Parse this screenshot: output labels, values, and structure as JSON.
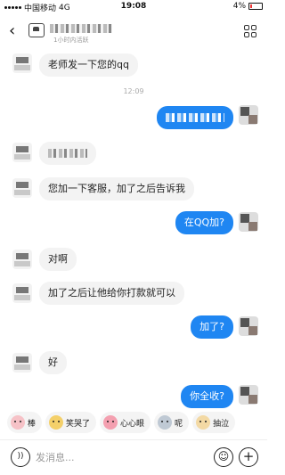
{
  "status_bar": {
    "carrier": "中国移动",
    "network": "4G",
    "time": "19:08",
    "battery": "4%"
  },
  "header": {
    "back_icon": "chevron-left-icon",
    "subtitle": "1小时内活跃"
  },
  "messages": [
    {
      "side": "in",
      "text": "老师发一下您的qq"
    },
    {
      "type": "timestamp",
      "text": "12:09"
    },
    {
      "side": "out",
      "redacted": true
    },
    {
      "side": "in",
      "redacted": true
    },
    {
      "side": "in",
      "text": "您加一下客服，加了之后告诉我"
    },
    {
      "side": "out",
      "text": "在QQ加?"
    },
    {
      "side": "in",
      "text": "对啊"
    },
    {
      "side": "in",
      "text": "加了之后让他给你打款就可以"
    },
    {
      "side": "out",
      "text": "加了?"
    },
    {
      "side": "in",
      "text": "好"
    },
    {
      "side": "out",
      "text": "你全收?"
    }
  ],
  "emoji_suggestions": [
    {
      "label": "棒",
      "color": "#f6c2c7"
    },
    {
      "label": "笑哭了",
      "color": "#f4d06a"
    },
    {
      "label": "心心眼",
      "color": "#f4a0b0"
    },
    {
      "label": "呢",
      "color": "#bfc9d4"
    },
    {
      "label": "抽泣",
      "color": "#f3d9a4"
    }
  ],
  "input": {
    "placeholder": "发消息...",
    "voice_icon": "voice-icon",
    "emoji_icon": "smile-icon",
    "plus_icon": "plus-icon"
  },
  "colors": {
    "outgoing_bubble": "#1f86f2",
    "incoming_bubble": "#f3f3f3"
  }
}
